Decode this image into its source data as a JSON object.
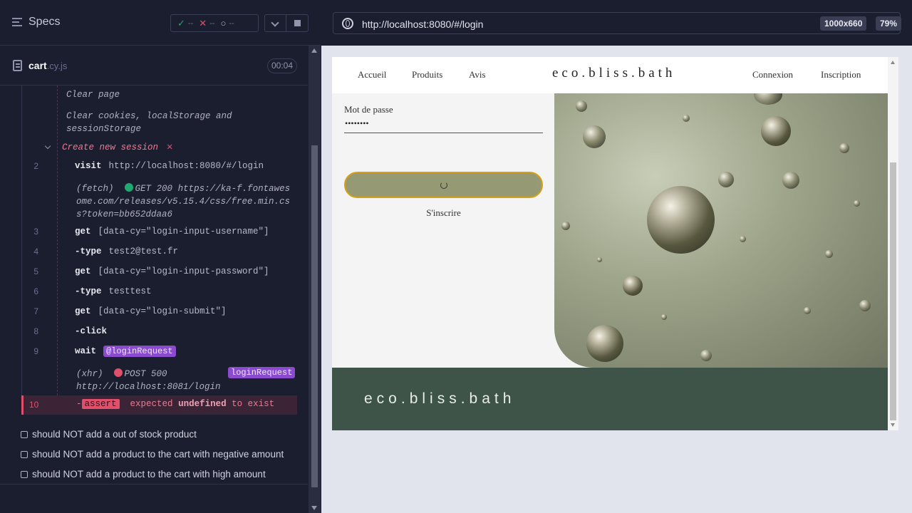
{
  "runner": {
    "specs_title": "Specs",
    "stats": {
      "passed": "--",
      "failed": "--",
      "pending": "--"
    },
    "file": {
      "name": "cart",
      "ext": ".cy.js",
      "time": "00:04"
    },
    "log": {
      "clear_page": "Clear page",
      "clear_storage": "Clear cookies, localStorage and sessionStorage",
      "session": "Create new session",
      "commands": [
        {
          "num": "2",
          "cmd": "visit",
          "arg": "http://localhost:8080/#/login"
        },
        {
          "num": "3",
          "cmd": "get",
          "arg": "[data-cy=\"login-input-username\"]"
        },
        {
          "num": "4",
          "cmd": "-type",
          "arg": "test2@test.fr"
        },
        {
          "num": "5",
          "cmd": "get",
          "arg": "[data-cy=\"login-input-password\"]"
        },
        {
          "num": "6",
          "cmd": "-type",
          "arg": "testtest"
        },
        {
          "num": "7",
          "cmd": "get",
          "arg": "[data-cy=\"login-submit\"]"
        },
        {
          "num": "8",
          "cmd": "-click",
          "arg": ""
        },
        {
          "num": "9",
          "cmd": "wait",
          "arg": "@loginRequest"
        }
      ],
      "fetch": {
        "label": "(fetch)",
        "status": "GET 200",
        "url": "https://ka-f.fontawesome.com/releases/v5.15.4/css/free.min.css?token=bb652ddaa6"
      },
      "xhr": {
        "label": "(xhr)",
        "status": "POST 500",
        "url": "http://localhost:8081/login",
        "alias": "loginRequest"
      },
      "error": {
        "num": "10",
        "dash": "-",
        "tag": "assert",
        "w1": "expected",
        "w2": "undefined",
        "w3": "to exist"
      }
    },
    "tests": [
      "should NOT add a out of stock product",
      "should NOT add a product to the cart with negative amount",
      "should NOT add a product to the cart with high amount"
    ],
    "colors": {
      "pass": "#1fa971",
      "fail": "#e0506a",
      "alias": "#8a4bcf"
    }
  },
  "aut": {
    "url": "http://localhost:8080/#/login",
    "viewport": "1000x660",
    "zoom": "79%"
  },
  "app": {
    "nav": {
      "home": "Accueil",
      "products": "Produits",
      "reviews": "Avis",
      "login": "Connexion",
      "signup": "Inscription"
    },
    "brand": "eco.bliss.bath",
    "password_label": "Mot de passe",
    "password_value": "••••••••",
    "signup_link": "S'inscrire",
    "footer_brand": "eco.bliss.bath"
  }
}
